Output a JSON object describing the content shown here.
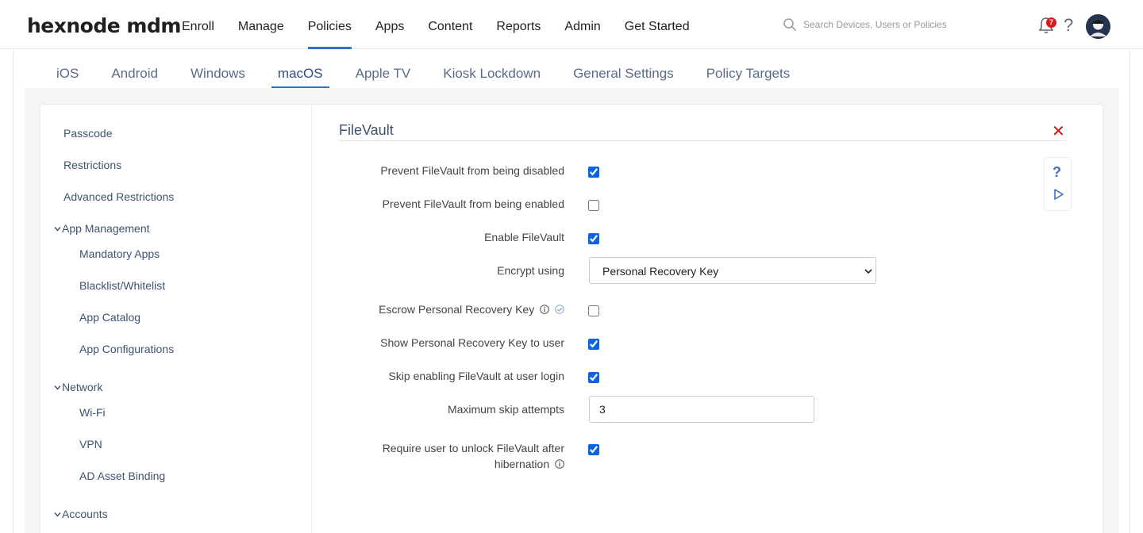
{
  "brand": {
    "logo_text": "hexnode mdm"
  },
  "nav": {
    "items": [
      "Enroll",
      "Manage",
      "Policies",
      "Apps",
      "Content",
      "Reports",
      "Admin",
      "Get Started"
    ],
    "active": "Policies"
  },
  "search": {
    "placeholder": "Search Devices, Users or Policies"
  },
  "notifications": {
    "count": "7"
  },
  "help": {
    "label": "?"
  },
  "tabs": {
    "items": [
      "iOS",
      "Android",
      "Windows",
      "macOS",
      "Apple TV",
      "Kiosk Lockdown",
      "General Settings",
      "Policy Targets"
    ],
    "active": "macOS"
  },
  "sidebar": {
    "top_items": [
      "Passcode",
      "Restrictions",
      "Advanced Restrictions"
    ],
    "groups": [
      {
        "label": "App Management",
        "items": [
          "Mandatory Apps",
          "Blacklist/Whitelist",
          "App Catalog",
          "App Configurations"
        ]
      },
      {
        "label": "Network",
        "items": [
          "Wi-Fi",
          "VPN",
          "AD Asset Binding"
        ]
      },
      {
        "label": "Accounts",
        "items": []
      }
    ]
  },
  "section": {
    "title": "FileVault"
  },
  "form": {
    "prevent_disable": {
      "label": "Prevent FileVault from being disabled",
      "checked": true
    },
    "prevent_enable": {
      "label": "Prevent FileVault from being enabled",
      "checked": false
    },
    "enable": {
      "label": "Enable FileVault",
      "checked": true
    },
    "encrypt_using": {
      "label": "Encrypt using",
      "value": "Personal Recovery Key"
    },
    "escrow": {
      "label": "Escrow Personal Recovery Key",
      "checked": false
    },
    "show_key": {
      "label": "Show Personal Recovery Key to user",
      "checked": true
    },
    "skip_login": {
      "label": "Skip enabling FileVault at user login",
      "checked": true
    },
    "max_skip": {
      "label": "Maximum skip attempts",
      "value": "3"
    },
    "require_unlock": {
      "label_line1": "Require user to unlock FileVault after",
      "label_line2": "hibernation",
      "checked": true
    }
  },
  "colors": {
    "accent": "#2f6fd0",
    "close": "#d01010",
    "nav_text": "#405270"
  }
}
